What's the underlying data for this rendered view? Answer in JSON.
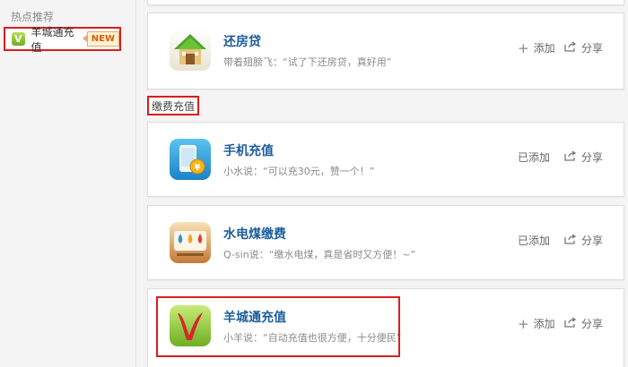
{
  "sidebar": {
    "section_title": "热点推荐",
    "item": {
      "icon": "v-logo-icon",
      "icon_letter": "V",
      "label": "羊城通充值",
      "badge": "NEW"
    }
  },
  "section": {
    "label": "缴费充值"
  },
  "apps": [
    {
      "name": "还房贷",
      "desc": "带着翅膀飞：“试了下还房贷，真好用”",
      "action": "添加",
      "share": "分享",
      "icon": "house-icon"
    },
    {
      "name": "手机充值",
      "desc": "小水说：“可以充30元，赞一个！”",
      "action": "已添加",
      "share": "分享",
      "icon": "phone-coin-icon"
    },
    {
      "name": "水电煤缴费",
      "desc": "Q-sin说：“缴水电煤，真是省时又方便！~”",
      "action": "已添加",
      "share": "分享",
      "icon": "utilities-icon"
    },
    {
      "name": "羊城通充值",
      "desc": "小羊说：“自动充值也很方便，十分便民”",
      "action": "添加",
      "share": "分享",
      "icon": "v-logo-icon"
    }
  ],
  "colors": {
    "highlight": "#d81e1e",
    "app_name": "#1c5d9b",
    "badge": "#e05a00"
  }
}
